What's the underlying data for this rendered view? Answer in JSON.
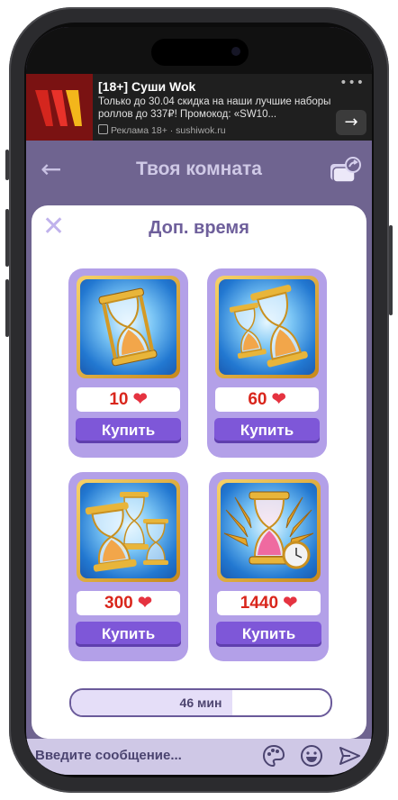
{
  "ad": {
    "title": "[18+] Суши Wok",
    "text": "Только до 30.04 скидка на наши лучшие наборы роллов до 337₽! Промокод: «SW10...",
    "meta": "Реклама 18+ · sushiwok.ru",
    "dots": "•••",
    "arrow": "→"
  },
  "header": {
    "back": "←",
    "title": "Твоя комната"
  },
  "modal": {
    "close": "✕",
    "title": "Доп. время",
    "cards": [
      {
        "price": "10",
        "buy_label": "Купить"
      },
      {
        "price": "60",
        "buy_label": "Купить"
      },
      {
        "price": "300",
        "buy_label": "Купить"
      },
      {
        "price": "1440",
        "buy_label": "Купить"
      }
    ],
    "heart": "❤",
    "time_label": "46 мин",
    "time_progress_percent": 62
  },
  "footer": {
    "placeholder": "Введите сообщение..."
  },
  "colors": {
    "accent": "#7e57d8",
    "card_bg": "#b3a0e8",
    "price_red": "#d9261c",
    "header_bg": "#6f6490"
  }
}
